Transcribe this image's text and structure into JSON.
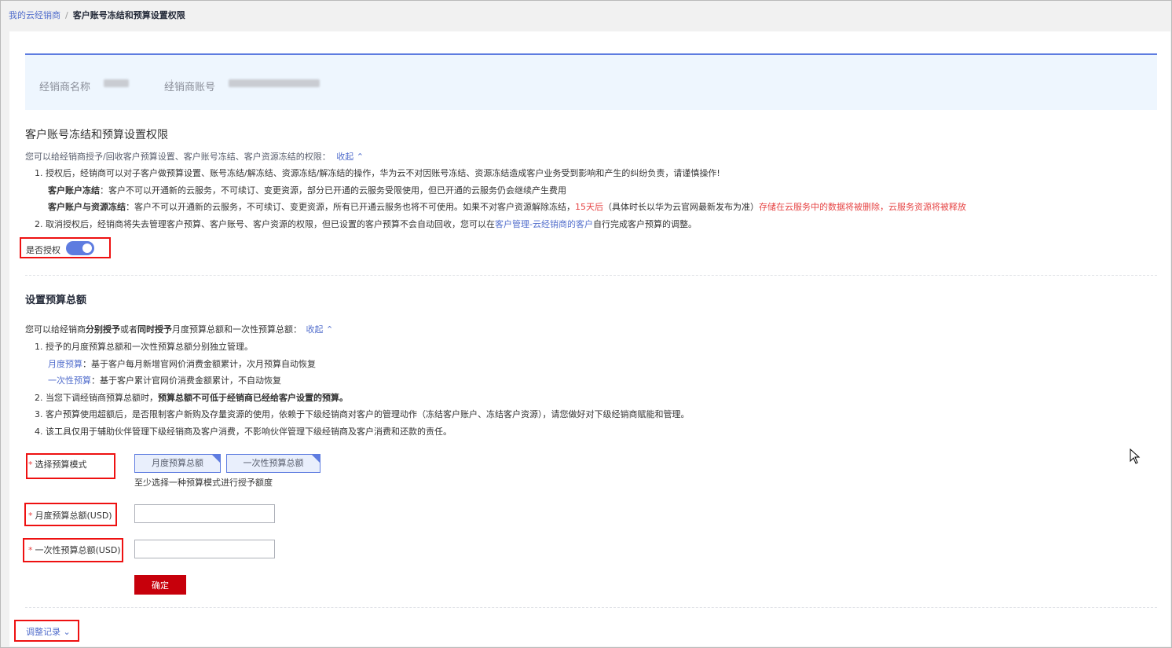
{
  "breadcrumb": {
    "parent": "我的云经销商",
    "separator": "/",
    "current": "客户账号冻结和预算设置权限"
  },
  "info": {
    "name_label": "经销商名称",
    "account_label": "经销商账号"
  },
  "freeze_section": {
    "title": "客户账号冻结和预算设置权限",
    "intro": "您可以给经销商授予/回收客户预算设置、客户账号冻结、客户资源冻结的权限：",
    "collapse": "收起",
    "item1": "1. 授权后，经销商可以对子客户做预算设置、账号冻结/解冻结、资源冻结/解冻结的操作，华为云不对因账号冻结、资源冻结造成客户业务受到影响和产生的纠纷负责，请谨慎操作!",
    "freeze_account_title": "客户账户冻结",
    "freeze_account_desc": "：客户不可以开通新的云服务，不可续订、变更资源，部分已开通的云服务受限使用，但已开通的云服务仍会继续产生费用",
    "freeze_resource_title": "客户账户与资源冻结",
    "freeze_resource_desc": "：客户不可以开通新的云服务，不可续订、变更资源，所有已开通云服务也将不可使用。如果不对客户资源解除冻结，",
    "days": "15天后",
    "days_note": "（具体时长以华为云官网最新发布为准）",
    "warning": "存储在云服务中的数据将被删除，云服务资源将被释放",
    "item2_prefix": "2. 取消授权后，经销商将失去管理客户预算、客户账号、客户资源的权限，但已设置的客户预算不会自动回收，您可以在",
    "item2_link": "客户管理-云经销商的客户",
    "item2_suffix": "自行完成客户预算的调整。",
    "toggle_label": "是否授权"
  },
  "budget_section": {
    "title": "设置预算总额",
    "intro_a": "您可以给经销商",
    "intro_b": "分别授予",
    "intro_c": "或者",
    "intro_d": "同时授予",
    "intro_e": "月度预算总额和一次性预算总额：",
    "collapse": "收起",
    "item1": "1. 授予的月度预算总额和一次性预算总额分别独立管理。",
    "monthly_name": "月度预算",
    "monthly_desc": "：基于客户每月新增官网价消费金额累计，次月预算自动恢复",
    "onetime_name": "一次性预算",
    "onetime_desc": "：基于客户累计官网价消费金额累计，不自动恢复",
    "item2_prefix": "2. 当您下调经销商预算总额时，",
    "item2_bold": "预算总额不可低于经销商已经给客户设置的预算。",
    "item3": "3. 客户预算使用超额后，是否限制客户新购及存量资源的使用，依赖于下级经销商对客户的管理动作（冻结客户账户、冻结客户资源），请您做好对下级经销商赋能和管理。",
    "item4": "4. 该工具仅用于辅助伙伴管理下级经销商及客户消费，不影响伙伴管理下级经销商及客户消费和还款的责任。"
  },
  "form": {
    "required_mark": "*",
    "mode_label": "选择预算模式",
    "mode_option_monthly": "月度预算总额",
    "mode_option_onetime": "一次性预算总额",
    "mode_hint": "至少选择一种预算模式进行授予额度",
    "monthly_label": "月度预算总额(USD)",
    "onetime_label": "一次性预算总额(USD)",
    "monthly_value": "",
    "onetime_value": "",
    "confirm": "确定"
  },
  "history": {
    "label": "调整记录"
  }
}
